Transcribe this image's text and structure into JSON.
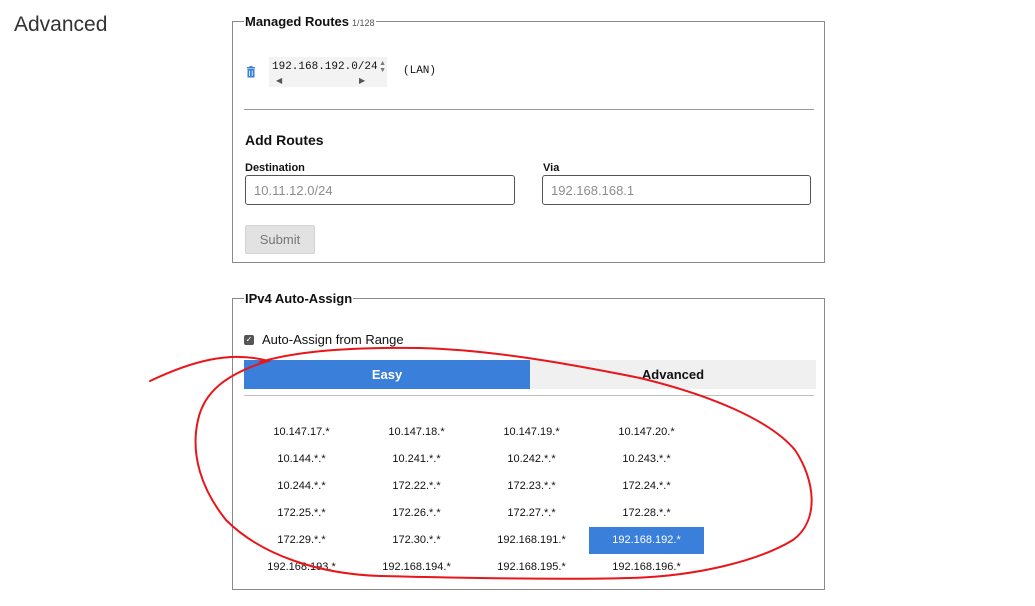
{
  "page": {
    "title": "Advanced"
  },
  "managed_routes": {
    "legend": "Managed Routes",
    "count": "1/128",
    "route": {
      "destination": "192.168.192.0/24",
      "via": "(LAN)"
    }
  },
  "add_routes": {
    "title": "Add Routes",
    "destination_label": "Destination",
    "destination_placeholder": "10.11.12.0/24",
    "via_label": "Via",
    "via_placeholder": "192.168.168.1",
    "submit_label": "Submit"
  },
  "ipv4": {
    "legend": "IPv4 Auto-Assign",
    "checkbox_label": "Auto-Assign from Range",
    "tabs": {
      "easy": "Easy",
      "advanced": "Advanced"
    },
    "ranges": [
      "10.147.17.*",
      "10.147.18.*",
      "10.147.19.*",
      "10.147.20.*",
      "10.144.*.*",
      "10.241.*.*",
      "10.242.*.*",
      "10.243.*.*",
      "10.244.*.*",
      "172.22.*.*",
      "172.23.*.*",
      "172.24.*.*",
      "172.25.*.*",
      "172.26.*.*",
      "172.27.*.*",
      "172.28.*.*",
      "172.29.*.*",
      "172.30.*.*",
      "192.168.191.*",
      "192.168.192.*",
      "192.168.193.*",
      "192.168.194.*",
      "192.168.195.*",
      "192.168.196.*"
    ],
    "selected_range": "192.168.192.*"
  },
  "colors": {
    "accent": "#3a7fd9",
    "annotation": "#e8161b"
  }
}
